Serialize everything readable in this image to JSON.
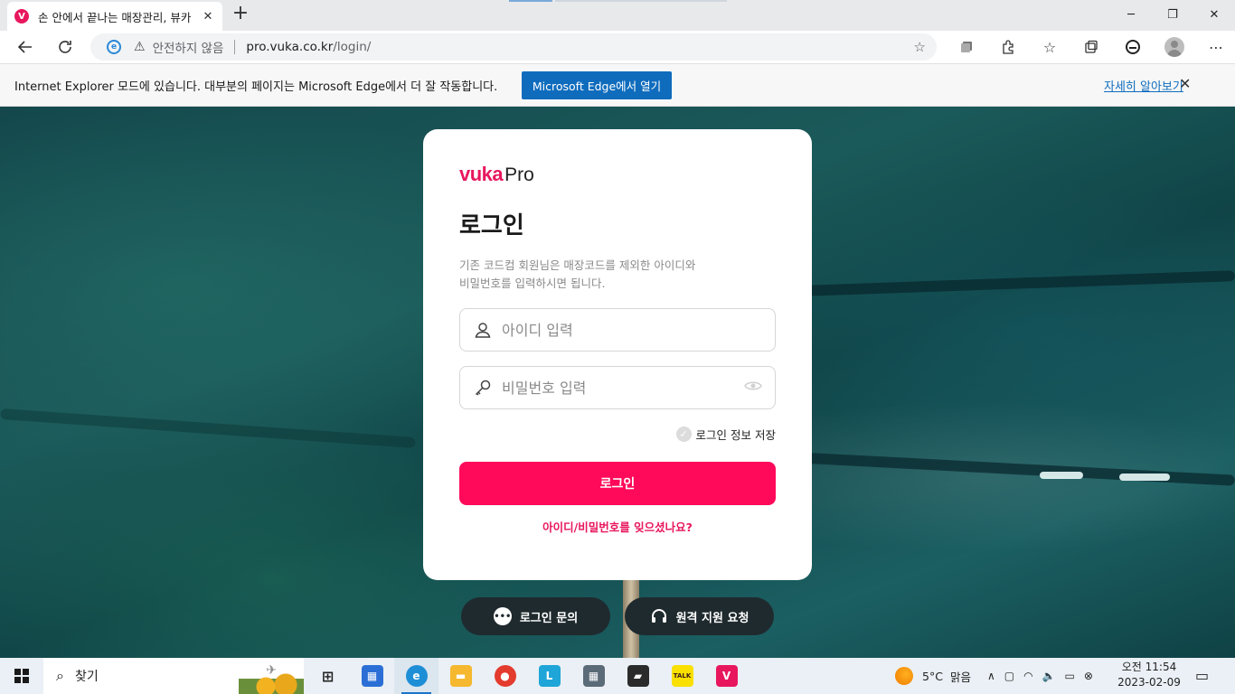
{
  "browser": {
    "tab_title": "손 안에서 끝나는 매장관리, 뷰카",
    "tab_favicon_letter": "V",
    "tab_close": "✕",
    "new_tab": "+",
    "window_controls": {
      "minimize": "─",
      "maximize": "❐",
      "close": "✕"
    },
    "address": {
      "security_text": "안전하지 않음",
      "url_host": "pro.vuka.co.kr",
      "url_path": "/login/"
    },
    "icons": [
      "back-icon",
      "refresh-icon",
      "ie-mode-icon",
      "warning-icon",
      "add-favorite-icon",
      "collections-icon",
      "extensions-icon",
      "favorites-icon",
      "tab-actions-icon",
      "edge-icon",
      "profile-icon",
      "more-icon"
    ]
  },
  "ie_bar": {
    "message": "Internet Explorer 모드에 있습니다. 대부분의 페이지는 Microsoft Edge에서 더 잘 작동합니다.",
    "open_button": "Microsoft Edge에서 열기",
    "learn_more": "자세히 알아보기",
    "close": "✕"
  },
  "login": {
    "logo_vuka": "vuka",
    "logo_pro": "Pro",
    "title": "로그인",
    "description_line1": "기존 코드컴 회원님은 매장코드를 제외한 아이디와",
    "description_line2": "비밀번호를 입력하시면 됩니다.",
    "id_placeholder": "아이디 입력",
    "password_placeholder": "비밀번호 입력",
    "remember_label": "로그인 정보 저장",
    "remember_checked": false,
    "login_button": "로그인",
    "forgot_link": "아이디/비밀번호를 잊으셨나요?",
    "brand_color": "#e8175d",
    "button_color": "#ff0a5a"
  },
  "support": {
    "login_inquiry": "로그인 문의",
    "remote_support": "원격 지원 요청"
  },
  "taskbar": {
    "search_label": "찾기",
    "apps": [
      {
        "name": "task-view",
        "glyph": "⊞",
        "color": "#eaf0f5"
      },
      {
        "name": "microsoft-store",
        "glyph": "▦",
        "color": "#2b6fd6"
      },
      {
        "name": "edge",
        "glyph": "e",
        "color": "#1e8fd6"
      },
      {
        "name": "file-explorer",
        "glyph": "▬",
        "color": "#f5b82e"
      },
      {
        "name": "chrome",
        "glyph": "●",
        "color": "#e33b2e"
      },
      {
        "name": "app-l",
        "glyph": "L",
        "color": "#1fa5d8"
      },
      {
        "name": "calculator",
        "glyph": "▦",
        "color": "#5b6b78"
      },
      {
        "name": "sticky-notes",
        "glyph": "▰",
        "color": "#2b2b2b"
      },
      {
        "name": "kakaotalk",
        "glyph": "TALK",
        "color": "#f9e000"
      },
      {
        "name": "vuka",
        "glyph": "V",
        "color": "#e8175d"
      }
    ],
    "weather_temp": "5°C",
    "weather_text": "맑음",
    "time_line1": "오전 11:54",
    "time_line2": "2023-02-09"
  }
}
